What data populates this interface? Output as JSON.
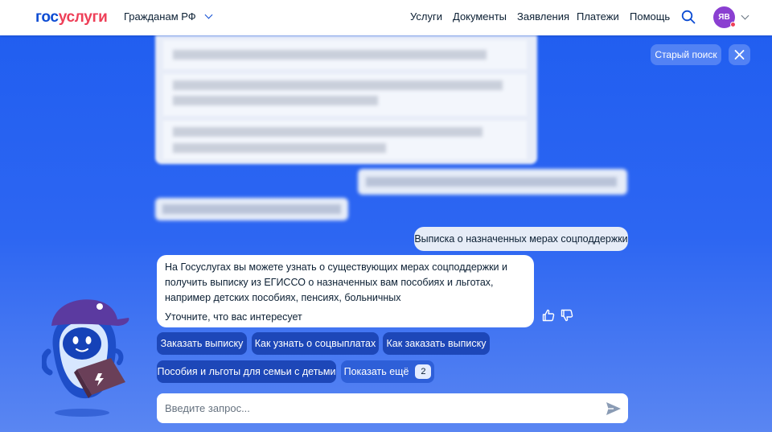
{
  "header": {
    "logo_part1": "гос",
    "logo_part2": "услуги",
    "region": "Гражданам РФ",
    "nav": [
      "Услуги",
      "Документы",
      "Заявления",
      "Платежи",
      "Помощь"
    ],
    "avatar_initials": "ЯВ",
    "icons": {
      "search": "search-icon",
      "chevron": "chevron-down-icon"
    }
  },
  "controls": {
    "old_search": "Старый поиск",
    "close": "close-icon"
  },
  "chat": {
    "user_message": "Выписка о назначенных мерах соцподдержки",
    "bot_message": "На Госуслугах вы можете узнать о существующих мерах соцподдержки и получить выписку из ЕГИССО о назначенных вам пособиях и льготах, например детских пособиях, пенсиях, больничных",
    "bot_question": "Уточните, что вас интересует",
    "suggestions": [
      "Заказать выписку",
      "Как узнать о соцвыплатах",
      "Как заказать выписку",
      "Пособия и льготы для семьи с детьми"
    ],
    "show_more": "Показать ещё",
    "show_more_count": "2"
  },
  "input": {
    "placeholder": "Введите запрос...",
    "value": ""
  },
  "colors": {
    "brand_blue": "#0d4cd3",
    "brand_red": "#ee3f58",
    "chip": "#1d47b8",
    "background": "#2d66f2"
  }
}
